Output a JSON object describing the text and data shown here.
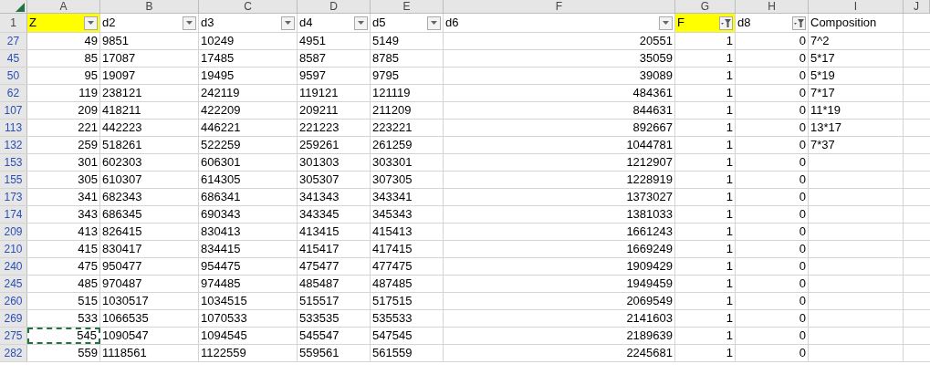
{
  "column_letters": [
    "A",
    "B",
    "C",
    "D",
    "E",
    "F",
    "G",
    "H",
    "I",
    "J"
  ],
  "header_row": {
    "number": "1",
    "cells": [
      {
        "text": "Z",
        "filter_button": true,
        "filtered": false,
        "highlighted": true
      },
      {
        "text": "d2",
        "filter_button": true,
        "filtered": false,
        "highlighted": false
      },
      {
        "text": "d3",
        "filter_button": true,
        "filtered": false,
        "highlighted": false
      },
      {
        "text": "d4",
        "filter_button": true,
        "filtered": false,
        "highlighted": false
      },
      {
        "text": "d5",
        "filter_button": true,
        "filtered": false,
        "highlighted": false
      },
      {
        "text": "d6",
        "filter_button": true,
        "filtered": false,
        "highlighted": false
      },
      {
        "text": "F",
        "filter_button": true,
        "filtered": true,
        "highlighted": true
      },
      {
        "text": "d8",
        "filter_button": true,
        "filtered": true,
        "highlighted": false
      },
      {
        "text": "Composition",
        "filter_button": false,
        "highlighted": false
      }
    ]
  },
  "rows": [
    {
      "number": "27",
      "marquee": false,
      "cells": [
        "49",
        "9851",
        "10249",
        "4951",
        "5149",
        "20551",
        "1",
        "0",
        "7^2"
      ]
    },
    {
      "number": "45",
      "marquee": false,
      "cells": [
        "85",
        "17087",
        "17485",
        "8587",
        "8785",
        "35059",
        "1",
        "0",
        "5*17"
      ]
    },
    {
      "number": "50",
      "marquee": false,
      "cells": [
        "95",
        "19097",
        "19495",
        "9597",
        "9795",
        "39089",
        "1",
        "0",
        "5*19"
      ]
    },
    {
      "number": "62",
      "marquee": false,
      "cells": [
        "119",
        "238121",
        "242119",
        "119121",
        "121119",
        "484361",
        "1",
        "0",
        "7*17"
      ]
    },
    {
      "number": "107",
      "marquee": false,
      "cells": [
        "209",
        "418211",
        "422209",
        "209211",
        "211209",
        "844631",
        "1",
        "0",
        "11*19"
      ]
    },
    {
      "number": "113",
      "marquee": false,
      "cells": [
        "221",
        "442223",
        "446221",
        "221223",
        "223221",
        "892667",
        "1",
        "0",
        "13*17"
      ]
    },
    {
      "number": "132",
      "marquee": false,
      "cells": [
        "259",
        "518261",
        "522259",
        "259261",
        "261259",
        "1044781",
        "1",
        "0",
        "7*37"
      ]
    },
    {
      "number": "153",
      "marquee": false,
      "cells": [
        "301",
        "602303",
        "606301",
        "301303",
        "303301",
        "1212907",
        "1",
        "0"
      ]
    },
    {
      "number": "155",
      "marquee": false,
      "cells": [
        "305",
        "610307",
        "614305",
        "305307",
        "307305",
        "1228919",
        "1",
        "0"
      ]
    },
    {
      "number": "173",
      "marquee": false,
      "cells": [
        "341",
        "682343",
        "686341",
        "341343",
        "343341",
        "1373027",
        "1",
        "0"
      ]
    },
    {
      "number": "174",
      "marquee": false,
      "cells": [
        "343",
        "686345",
        "690343",
        "343345",
        "345343",
        "1381033",
        "1",
        "0"
      ]
    },
    {
      "number": "209",
      "marquee": false,
      "cells": [
        "413",
        "826415",
        "830413",
        "413415",
        "415413",
        "1661243",
        "1",
        "0"
      ]
    },
    {
      "number": "210",
      "marquee": false,
      "cells": [
        "415",
        "830417",
        "834415",
        "415417",
        "417415",
        "1669249",
        "1",
        "0"
      ]
    },
    {
      "number": "240",
      "marquee": false,
      "cells": [
        "475",
        "950477",
        "954475",
        "475477",
        "477475",
        "1909429",
        "1",
        "0"
      ]
    },
    {
      "number": "245",
      "marquee": false,
      "cells": [
        "485",
        "970487",
        "974485",
        "485487",
        "487485",
        "1949459",
        "1",
        "0"
      ]
    },
    {
      "number": "260",
      "marquee": false,
      "cells": [
        "515",
        "1030517",
        "1034515",
        "515517",
        "517515",
        "2069549",
        "1",
        "0"
      ]
    },
    {
      "number": "269",
      "marquee": false,
      "cells": [
        "533",
        "1066535",
        "1070533",
        "533535",
        "535533",
        "2141603",
        "1",
        "0"
      ]
    },
    {
      "number": "275",
      "marquee": true,
      "cells": [
        "545",
        "1090547",
        "1094545",
        "545547",
        "547545",
        "2189639",
        "1",
        "0"
      ]
    },
    {
      "number": "282",
      "marquee": false,
      "cells": [
        "559",
        "1118561",
        "1122559",
        "559561",
        "561559",
        "2245681",
        "1",
        "0"
      ]
    }
  ]
}
